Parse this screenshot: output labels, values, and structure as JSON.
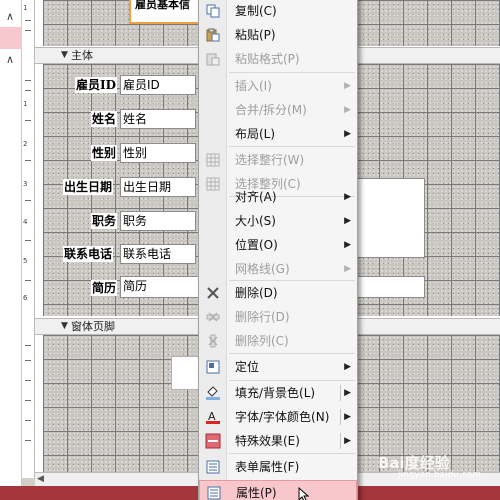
{
  "colors": {
    "accent": "#f7c7cb",
    "status_bar": "#a5363b",
    "header_outline": "#f0a040"
  },
  "ruler": {
    "numbers": [
      "1",
      "1",
      "2",
      "3",
      "4",
      "5",
      "6"
    ]
  },
  "sections": {
    "main": "主体",
    "footer": "窗体页脚"
  },
  "header": {
    "title": "雇员基本信"
  },
  "fields": [
    {
      "label": "雇员ID",
      "value": "雇员ID"
    },
    {
      "label": "姓名",
      "value": "姓名"
    },
    {
      "label": "性别",
      "value": "性别"
    },
    {
      "label": "出生日期",
      "value": "出生日期"
    },
    {
      "label": "职务",
      "value": "职务"
    },
    {
      "label": "联系电话",
      "value": "联系电话"
    },
    {
      "label": "简历",
      "value": "简历"
    }
  ],
  "menu": {
    "items": [
      {
        "label": "复制(C)",
        "icon": "copy-icon",
        "enabled": true
      },
      {
        "label": "粘贴(P)",
        "icon": "paste-icon",
        "enabled": true
      },
      {
        "label": "粘贴格式(P)",
        "icon": "paste-format-icon",
        "enabled": false
      },
      {
        "label": "插入(I)",
        "icon": "",
        "enabled": false,
        "submenu": true
      },
      {
        "label": "合并/拆分(M)",
        "icon": "",
        "enabled": false,
        "submenu": true
      },
      {
        "label": "布局(L)",
        "icon": "",
        "enabled": true,
        "submenu": true
      },
      {
        "label": "选择整行(W)",
        "icon": "select-row-icon",
        "enabled": false
      },
      {
        "label": "选择整列(C)",
        "icon": "select-column-icon",
        "enabled": false
      },
      {
        "label": "对齐(A)",
        "icon": "",
        "enabled": true,
        "submenu": true
      },
      {
        "label": "大小(S)",
        "icon": "",
        "enabled": true,
        "submenu": true
      },
      {
        "label": "位置(O)",
        "icon": "",
        "enabled": true,
        "submenu": true
      },
      {
        "label": "网格线(G)",
        "icon": "",
        "enabled": false,
        "submenu": true
      },
      {
        "label": "删除(D)",
        "icon": "delete-icon",
        "enabled": true
      },
      {
        "label": "删除行(D)",
        "icon": "delete-row-icon",
        "enabled": false
      },
      {
        "label": "删除列(C)",
        "icon": "delete-column-icon",
        "enabled": false
      },
      {
        "label": "定位",
        "icon": "position-icon",
        "enabled": true,
        "submenu": true
      },
      {
        "label": "填充/背景色(L)",
        "icon": "fill-color-icon",
        "enabled": true,
        "submenu": true,
        "split": true
      },
      {
        "label": "字体/字体颜色(N)",
        "icon": "font-color-icon",
        "enabled": true,
        "submenu": true,
        "split": true
      },
      {
        "label": "特殊效果(E)",
        "icon": "special-effect-icon",
        "enabled": true,
        "submenu": true,
        "split": true
      },
      {
        "label": "表单属性(F)",
        "icon": "form-properties-icon",
        "enabled": true
      },
      {
        "label": "属性(P)",
        "icon": "properties-icon",
        "enabled": true,
        "highlighted": true
      }
    ]
  },
  "watermark": {
    "main": "Bai度经验",
    "sub": "jingyan.baidu.com"
  }
}
